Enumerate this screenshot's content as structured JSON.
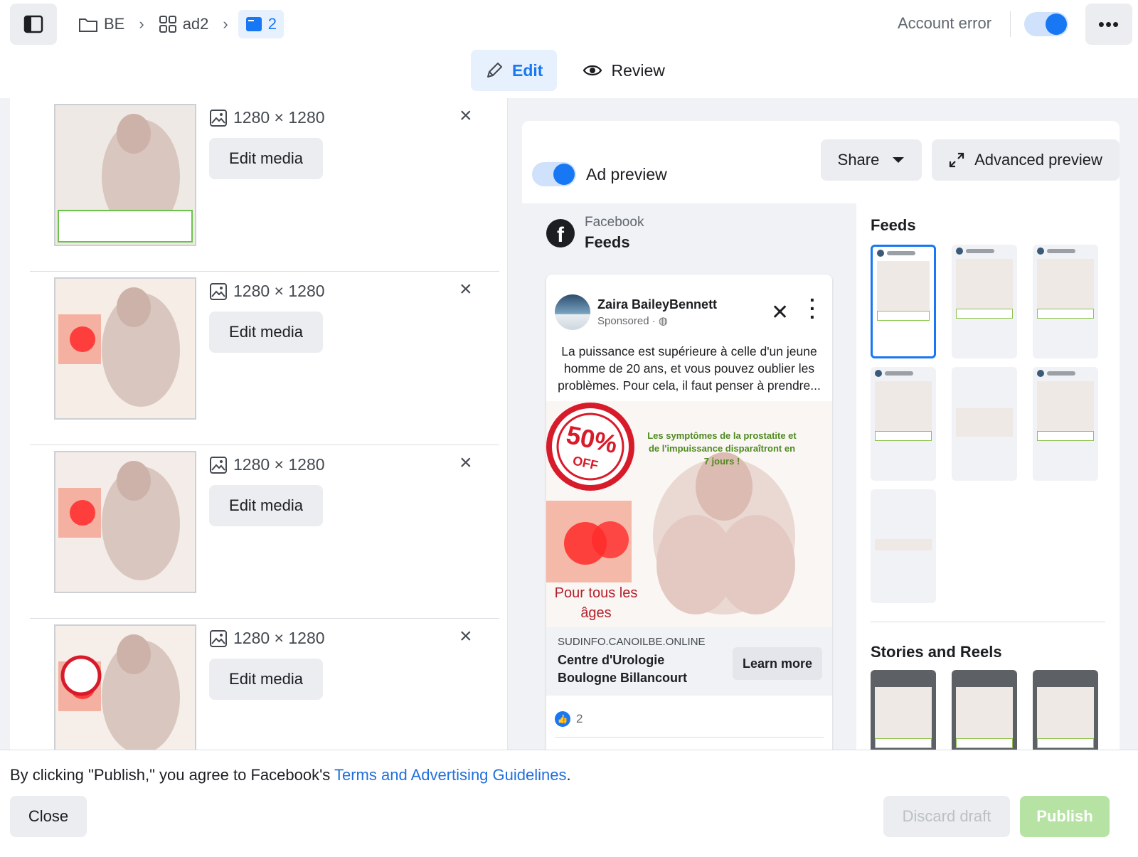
{
  "breadcrumb": {
    "campaign": "BE",
    "ad_set": "ad2",
    "ad": "2"
  },
  "header": {
    "account_status": "Account error",
    "more_label": "•••"
  },
  "mode_tabs": {
    "edit": "Edit",
    "review": "Review"
  },
  "media": {
    "items": [
      {
        "dimensions": "1280 × 1280",
        "edit_label": "Edit media",
        "remove_label": "×",
        "caption": "La puissance est supérieure à celle d'un jeune homme de 20 ans, et vous pouvez oublier les problèmes. Pour cela, il faut penser à prendre..."
      },
      {
        "dimensions": "1280 × 1280",
        "edit_label": "Edit media",
        "remove_label": "×",
        "caption": "Les symptômes de la prostatite et de l'impuissance disparaîtront en 7 jours !"
      },
      {
        "dimensions": "1280 × 1280",
        "edit_label": "Edit media",
        "remove_label": "×",
        "caption": "La puissance est supérieure à celle d'un jeune homme de 20 ans, et vous pouvez oublier les problèmes. Pour cela, il faut penser à prendre..."
      },
      {
        "dimensions": "1280 × 1280",
        "edit_label": "Edit media",
        "remove_label": "×",
        "caption": "La puissance est supérieure à celle d'un jeune homme de 20 ans, et vous pouvez oublier les problèmes. Pour cela, il faut penser à prendre..."
      }
    ]
  },
  "preview": {
    "toggle_label": "Ad preview",
    "share_label": "Share",
    "advanced_label": "Advanced preview",
    "platform": "Facebook",
    "placement": "Feeds",
    "post": {
      "page_name": "Zaira BaileyBennett",
      "sponsored": "Sponsored ·",
      "primary_text": "La puissance est supérieure à celle d'un jeune homme de 20 ans, et vous pouvez oublier les problèmes. Pour cela, il faut penser à prendre...",
      "image_badge_big": "50%",
      "image_badge_small": "OFF",
      "image_headline": "Les symptômes de la prostatite et de l'impuissance disparaîtront en 7 jours !",
      "image_subline": "Pour tous les âges",
      "link_domain": "SUDINFO.CANOILBE.ONLINE",
      "link_title": "Centre d'Urologie Boulogne Billancourt",
      "cta_label": "Learn more",
      "reaction_count": "2"
    },
    "placement_groups": {
      "feeds_title": "Feeds",
      "stories_title": "Stories and Reels"
    }
  },
  "footer": {
    "terms_prefix": "By clicking \"Publish,\" you agree to Facebook's ",
    "terms_link": "Terms and Advertising Guidelines",
    "terms_suffix": ".",
    "close_label": "Close",
    "discard_label": "Discard draft",
    "publish_label": "Publish"
  },
  "colors": {
    "accent": "#1877f2",
    "publish_disabled": "#b6e3a4",
    "link": "#216fdb"
  }
}
